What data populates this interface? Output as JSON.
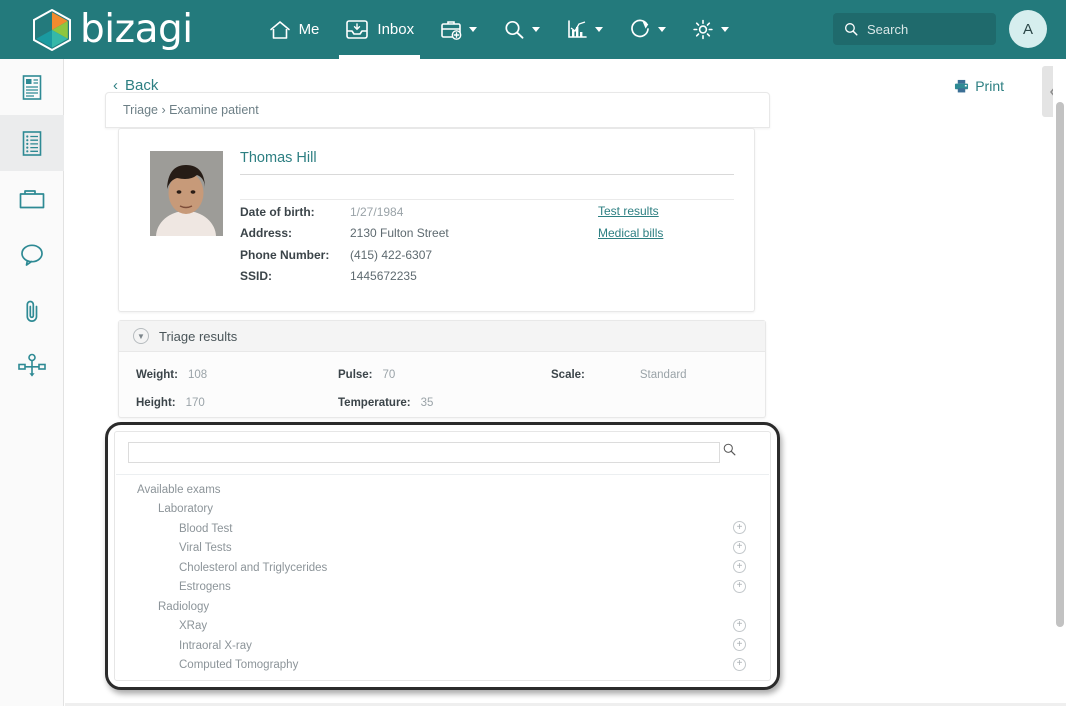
{
  "header": {
    "brand": "bizagi",
    "nav": [
      {
        "label": "Me",
        "icon": "home-icon",
        "active": false,
        "caret": false
      },
      {
        "label": "Inbox",
        "icon": "inbox-icon",
        "active": true,
        "caret": false
      },
      {
        "label": "",
        "icon": "new-case-icon",
        "active": false,
        "caret": true
      },
      {
        "label": "",
        "icon": "search-icon",
        "active": false,
        "caret": true
      },
      {
        "label": "",
        "icon": "analytics-icon",
        "active": false,
        "caret": true
      },
      {
        "label": "",
        "icon": "refresh-icon",
        "active": false,
        "caret": true
      },
      {
        "label": "",
        "icon": "gear-icon",
        "active": false,
        "caret": true
      }
    ],
    "search": {
      "placeholder": "Search",
      "value": "",
      "icon": "search-icon"
    },
    "avatar": {
      "initial": "A"
    }
  },
  "sidebar": {
    "items": [
      {
        "name": "summary",
        "icon": "summary-document-icon",
        "active": false
      },
      {
        "name": "form",
        "icon": "form-list-icon",
        "active": true
      },
      {
        "name": "documents",
        "icon": "folder-icon",
        "active": false
      },
      {
        "name": "comments",
        "icon": "comment-bubble-icon",
        "active": false
      },
      {
        "name": "attachments",
        "icon": "paperclip-icon",
        "active": false
      },
      {
        "name": "process",
        "icon": "process-diagram-icon",
        "active": false
      }
    ]
  },
  "toolbar": {
    "back_label": "Back",
    "back_icon": "chevron-left-icon",
    "print_label": "Print",
    "print_icon": "printer-icon",
    "collapse_icon": "chevron-left-icon"
  },
  "breadcrumb": "Triage › Examine patient",
  "patient": {
    "name": "Thomas Hill",
    "fields": [
      {
        "label": "Date of birth:",
        "value": "1/27/1984",
        "dim": true
      },
      {
        "label": "Address:",
        "value": "2130 Fulton Street",
        "dim": false
      },
      {
        "label": "Phone Number:",
        "value": "(415) 422-6307",
        "dim": false
      },
      {
        "label": "SSID:",
        "value": "1445672235",
        "dim": false
      }
    ],
    "links": [
      {
        "label": "Test results"
      },
      {
        "label": "Medical bills"
      }
    ]
  },
  "triage": {
    "title": "Triage results",
    "collapse_icon": "chevron-down-icon",
    "rows": [
      {
        "label": "Weight:",
        "value": "108"
      },
      {
        "label": "Pulse:",
        "value": "70"
      },
      {
        "label": "Scale:",
        "value": "Standard"
      },
      {
        "label": "Height:",
        "value": "170"
      },
      {
        "label": "Temperature:",
        "value": "35"
      }
    ]
  },
  "exams": {
    "search": {
      "value": "",
      "placeholder": "",
      "icon": "search-icon"
    },
    "tree": [
      {
        "label": "Available exams",
        "level": 0,
        "add": false
      },
      {
        "label": "Laboratory",
        "level": 1,
        "add": false
      },
      {
        "label": "Blood Test",
        "level": 2,
        "add": true
      },
      {
        "label": "Viral Tests",
        "level": 2,
        "add": true
      },
      {
        "label": "Cholesterol and Triglycerides",
        "level": 2,
        "add": true
      },
      {
        "label": "Estrogens",
        "level": 2,
        "add": true
      },
      {
        "label": "Radiology",
        "level": 1,
        "add": false
      },
      {
        "label": "XRay",
        "level": 2,
        "add": true
      },
      {
        "label": "Intraoral X-ray",
        "level": 2,
        "add": true
      },
      {
        "label": "Computed Tomography",
        "level": 2,
        "add": true
      }
    ],
    "add_icon": "plus-circle-icon"
  },
  "colors": {
    "brand_teal": "#237a7c",
    "link_teal": "#2d7f82",
    "highlight_border": "#2b2b2b"
  }
}
